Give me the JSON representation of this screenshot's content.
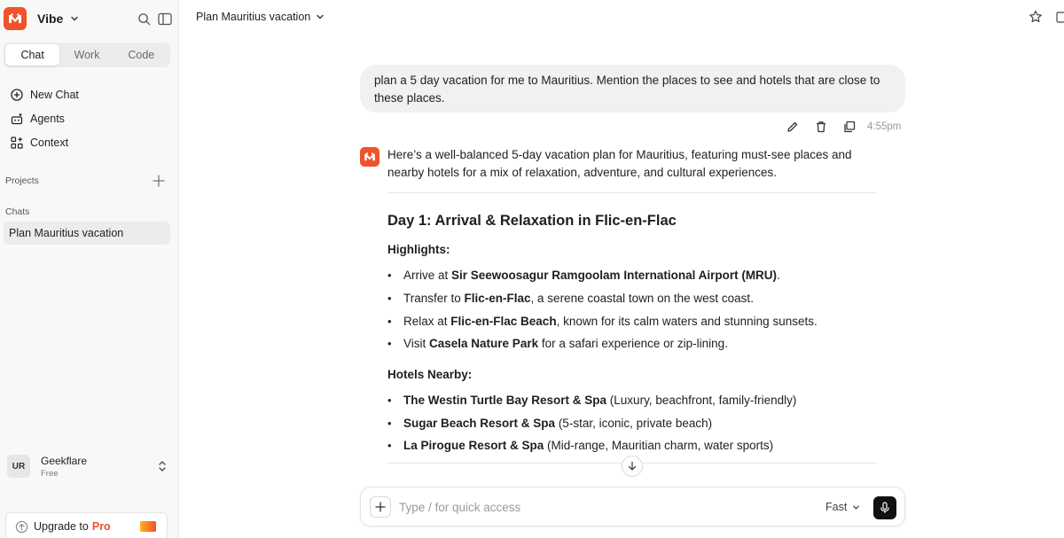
{
  "app": {
    "name": "Vibe"
  },
  "sidebar": {
    "tabs": [
      {
        "label": "Chat",
        "active": true
      },
      {
        "label": "Work",
        "active": false
      },
      {
        "label": "Code",
        "active": false
      }
    ],
    "nav": [
      {
        "label": "New Chat",
        "icon": "plus-circle-icon"
      },
      {
        "label": "Agents",
        "icon": "robot-icon"
      },
      {
        "label": "Context",
        "icon": "grid-plus-icon"
      }
    ],
    "projects_label": "Projects",
    "chats_label": "Chats",
    "chats": [
      {
        "label": "Plan Mauritius vacation",
        "active": true
      }
    ],
    "user": {
      "initials": "UR",
      "name": "Geekflare",
      "plan": "Free"
    },
    "upgrade": {
      "label": "Upgrade to",
      "highlight": "Pro"
    }
  },
  "header": {
    "chat_title": "Plan Mauritius vacation"
  },
  "conversation": {
    "user_message": "plan a 5 day vacation for me to Mauritius. Mention the places to see and hotels that are close to these places.",
    "time": "4:55pm",
    "answer": {
      "intro": "Here’s a well-balanced 5-day vacation plan for Mauritius, featuring must-see places and nearby hotels for a mix of relaxation, adventure, and cultural experiences.",
      "day_title": "Day 1: Arrival & Relaxation in Flic-en-Flac",
      "highlights_label": "Highlights:",
      "highlights": [
        {
          "pre": "Arrive at ",
          "bold": "Sir Seewoosagur Ramgoolam International Airport (MRU)",
          "post": "."
        },
        {
          "pre": "Transfer to ",
          "bold": "Flic-en-Flac",
          "post": ", a serene coastal town on the west coast."
        },
        {
          "pre": "Relax at ",
          "bold": "Flic-en-Flac Beach",
          "post": ", known for its calm waters and stunning sunsets."
        },
        {
          "pre": "Visit ",
          "bold": "Casela Nature Park",
          "post": " for a safari experience or zip-lining."
        }
      ],
      "hotels_label": "Hotels Nearby:",
      "hotels": [
        {
          "pre": "",
          "bold": "The Westin Turtle Bay Resort & Spa",
          "post": " (Luxury, beachfront, family-friendly)"
        },
        {
          "pre": "",
          "bold": "Sugar Beach Resort & Spa",
          "post": " (5-star, iconic, private beach)"
        },
        {
          "pre": "",
          "bold": "La Pirogue Resort & Spa",
          "post": " (Mid-range, Mauritian charm, water sports)"
        }
      ]
    }
  },
  "composer": {
    "placeholder": "Type / for quick access",
    "mode": "Fast"
  },
  "colors": {
    "accent": "#f0522b",
    "sidebar_bg": "#f8f8f7",
    "bubble_bg": "#f1f1f0"
  }
}
